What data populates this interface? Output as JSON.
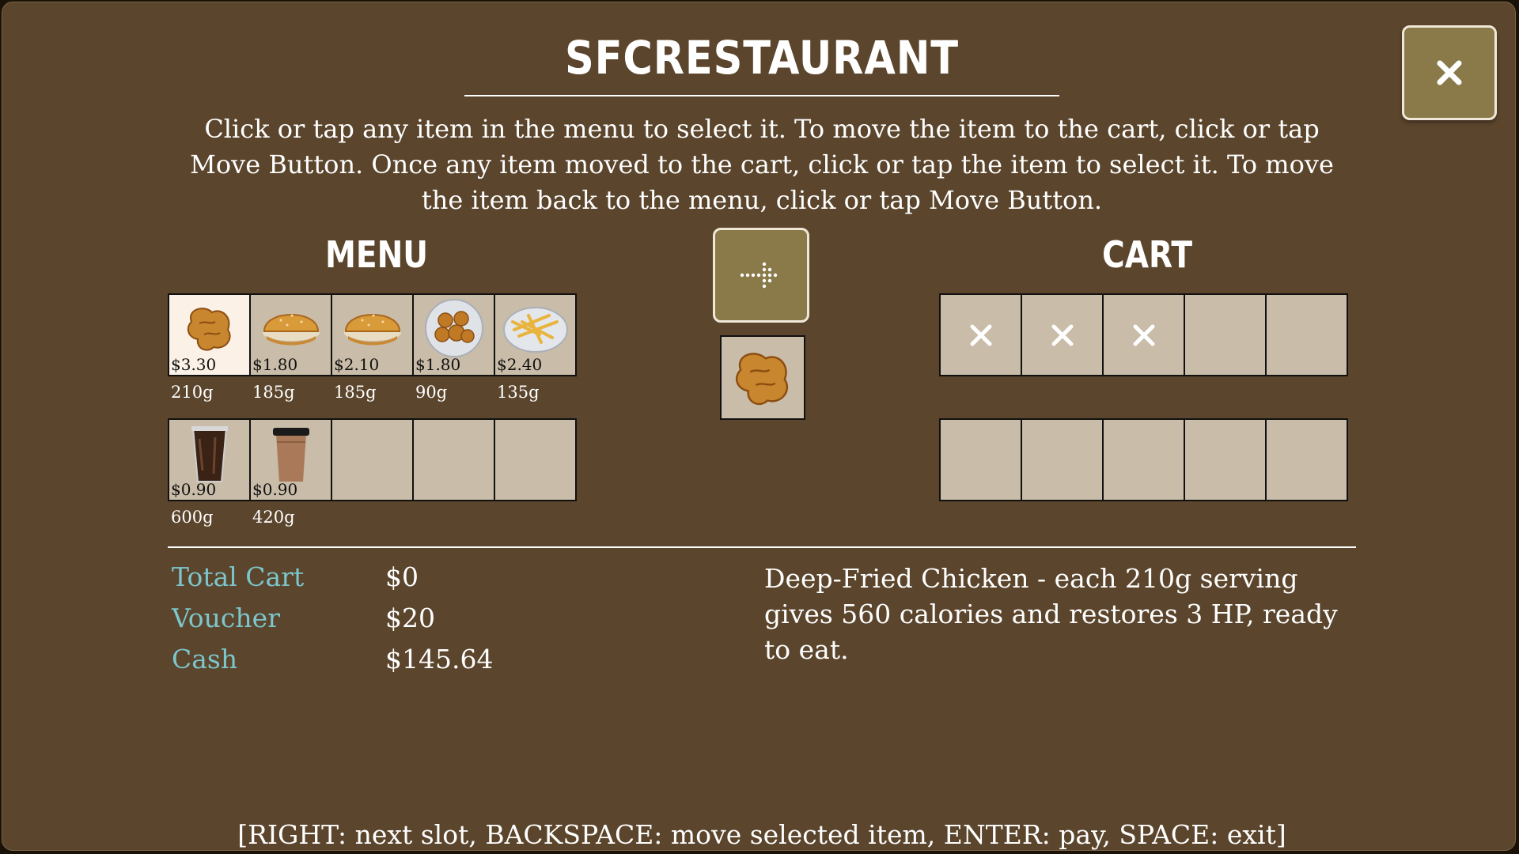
{
  "title": "SFCRESTAURANT",
  "instructions": "Click or tap any item in the menu to select it. To move the item to the cart, click or tap Move Button. Once any item moved to the cart, click or tap the item to select it. To move the item back to the menu, click or tap Move Button.",
  "menu": {
    "title": "MENU",
    "row1": [
      {
        "icon": "fried-chicken",
        "price": "$3.30",
        "weight": "210g",
        "selected": true
      },
      {
        "icon": "burger",
        "price": "$1.80",
        "weight": "185g"
      },
      {
        "icon": "burger",
        "price": "$2.10",
        "weight": "185g"
      },
      {
        "icon": "nuggets",
        "price": "$1.80",
        "weight": "90g"
      },
      {
        "icon": "fries",
        "price": "$2.40",
        "weight": "135g"
      }
    ],
    "row2": [
      {
        "icon": "cola-cup",
        "price": "$0.90",
        "weight": "600g"
      },
      {
        "icon": "coffee-cup",
        "price": "$0.90",
        "weight": "420g"
      },
      {},
      {},
      {}
    ]
  },
  "cart": {
    "title": "CART",
    "row1": [
      "locked",
      "locked",
      "locked",
      "empty",
      "empty"
    ],
    "row2": [
      "empty",
      "empty",
      "empty",
      "empty",
      "empty"
    ]
  },
  "selected_preview_icon": "fried-chicken",
  "stats": {
    "total_cart_label": "Total Cart",
    "total_cart_value": "$0",
    "voucher_label": "Voucher",
    "voucher_value": "$20",
    "cash_label": "Cash",
    "cash_value": "$145.64"
  },
  "description": "Deep-Fried Chicken - each 210g serving gives 560 calories and restores 3 HP, ready to eat.",
  "keys_hint": "[RIGHT: next slot, BACKSPACE: move selected item, ENTER: pay, SPACE: exit]",
  "colors": {
    "panel": "#5b452c",
    "button": "#8a7a4a",
    "slot": "#c9bca8",
    "label": "#7cc6cc"
  }
}
